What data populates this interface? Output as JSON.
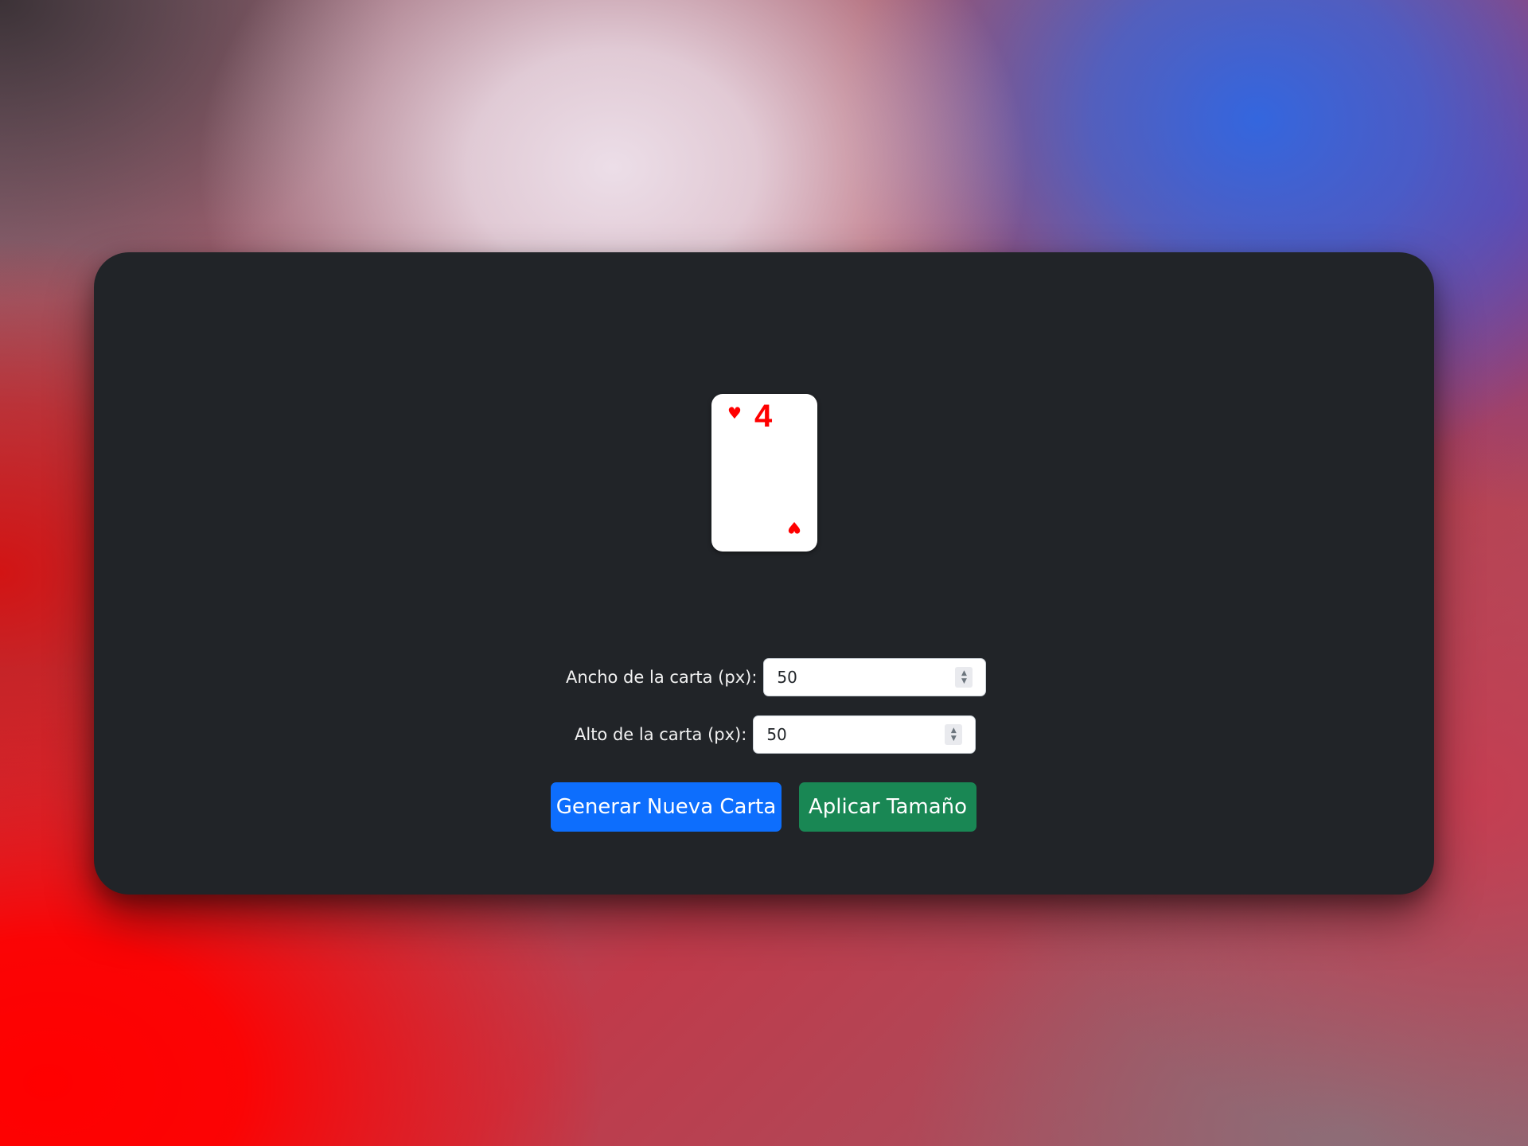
{
  "colors": {
    "panel": "#212428",
    "card": "#ffffff",
    "suit": "#ff0000",
    "primary_button": "#0d6efd",
    "success_button": "#198754"
  },
  "card": {
    "rank": "4",
    "suit_symbol": "♥",
    "suit_name": "heart-icon"
  },
  "form": {
    "width_label": "Ancho de la carta (px):",
    "width_value": "50",
    "height_label": "Alto de la carta (px):",
    "height_value": "50"
  },
  "buttons": {
    "generate_label": "Generar Nueva Carta",
    "apply_label": "Aplicar Tamaño"
  }
}
